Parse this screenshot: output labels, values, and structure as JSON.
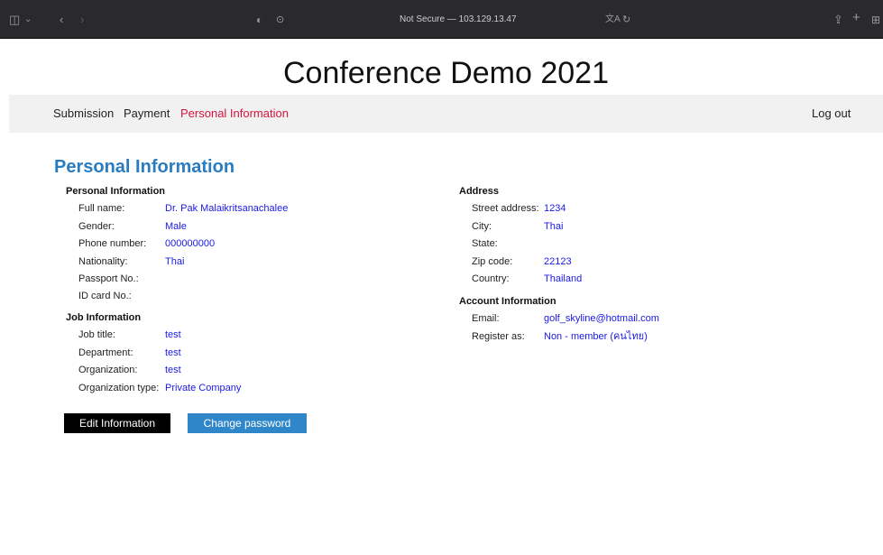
{
  "browser": {
    "address": "Not Secure — 103.129.13.47"
  },
  "site": {
    "title": "Conference Demo 2021"
  },
  "nav": {
    "submission": "Submission",
    "payment": "Payment",
    "personal_information": "Personal Information",
    "logout": "Log out"
  },
  "section_title": "Personal Information",
  "personal": {
    "heading": "Personal Information",
    "rows": [
      {
        "label": "Full name:",
        "value": "Dr. Pak Malaikritsanachalee"
      },
      {
        "label": "Gender:",
        "value": "Male"
      },
      {
        "label": "Phone number:",
        "value": "000000000"
      },
      {
        "label": "Nationality:",
        "value": "Thai"
      },
      {
        "label": "Passport No.:",
        "value": ""
      },
      {
        "label": "ID card No.:",
        "value": ""
      }
    ]
  },
  "job": {
    "heading": "Job Information",
    "rows": [
      {
        "label": "Job title:",
        "value": "test"
      },
      {
        "label": "Department:",
        "value": "test"
      },
      {
        "label": "Organization:",
        "value": "test"
      },
      {
        "label": "Organization type:",
        "value": "Private Company"
      }
    ]
  },
  "address": {
    "heading": "Address",
    "rows": [
      {
        "label": "Street address:",
        "value": "1234"
      },
      {
        "label": "City:",
        "value": "Thai"
      },
      {
        "label": "State:",
        "value": ""
      },
      {
        "label": "Zip code:",
        "value": "22123"
      },
      {
        "label": "Country:",
        "value": "Thailand"
      }
    ]
  },
  "account": {
    "heading": "Account Information",
    "rows": [
      {
        "label": "Email:",
        "value": "golf_skyline@hotmail.com"
      },
      {
        "label": "Register as:",
        "value": "Non - member (คนไทย)"
      }
    ]
  },
  "buttons": {
    "edit": "Edit Information",
    "change_password": "Change password"
  }
}
